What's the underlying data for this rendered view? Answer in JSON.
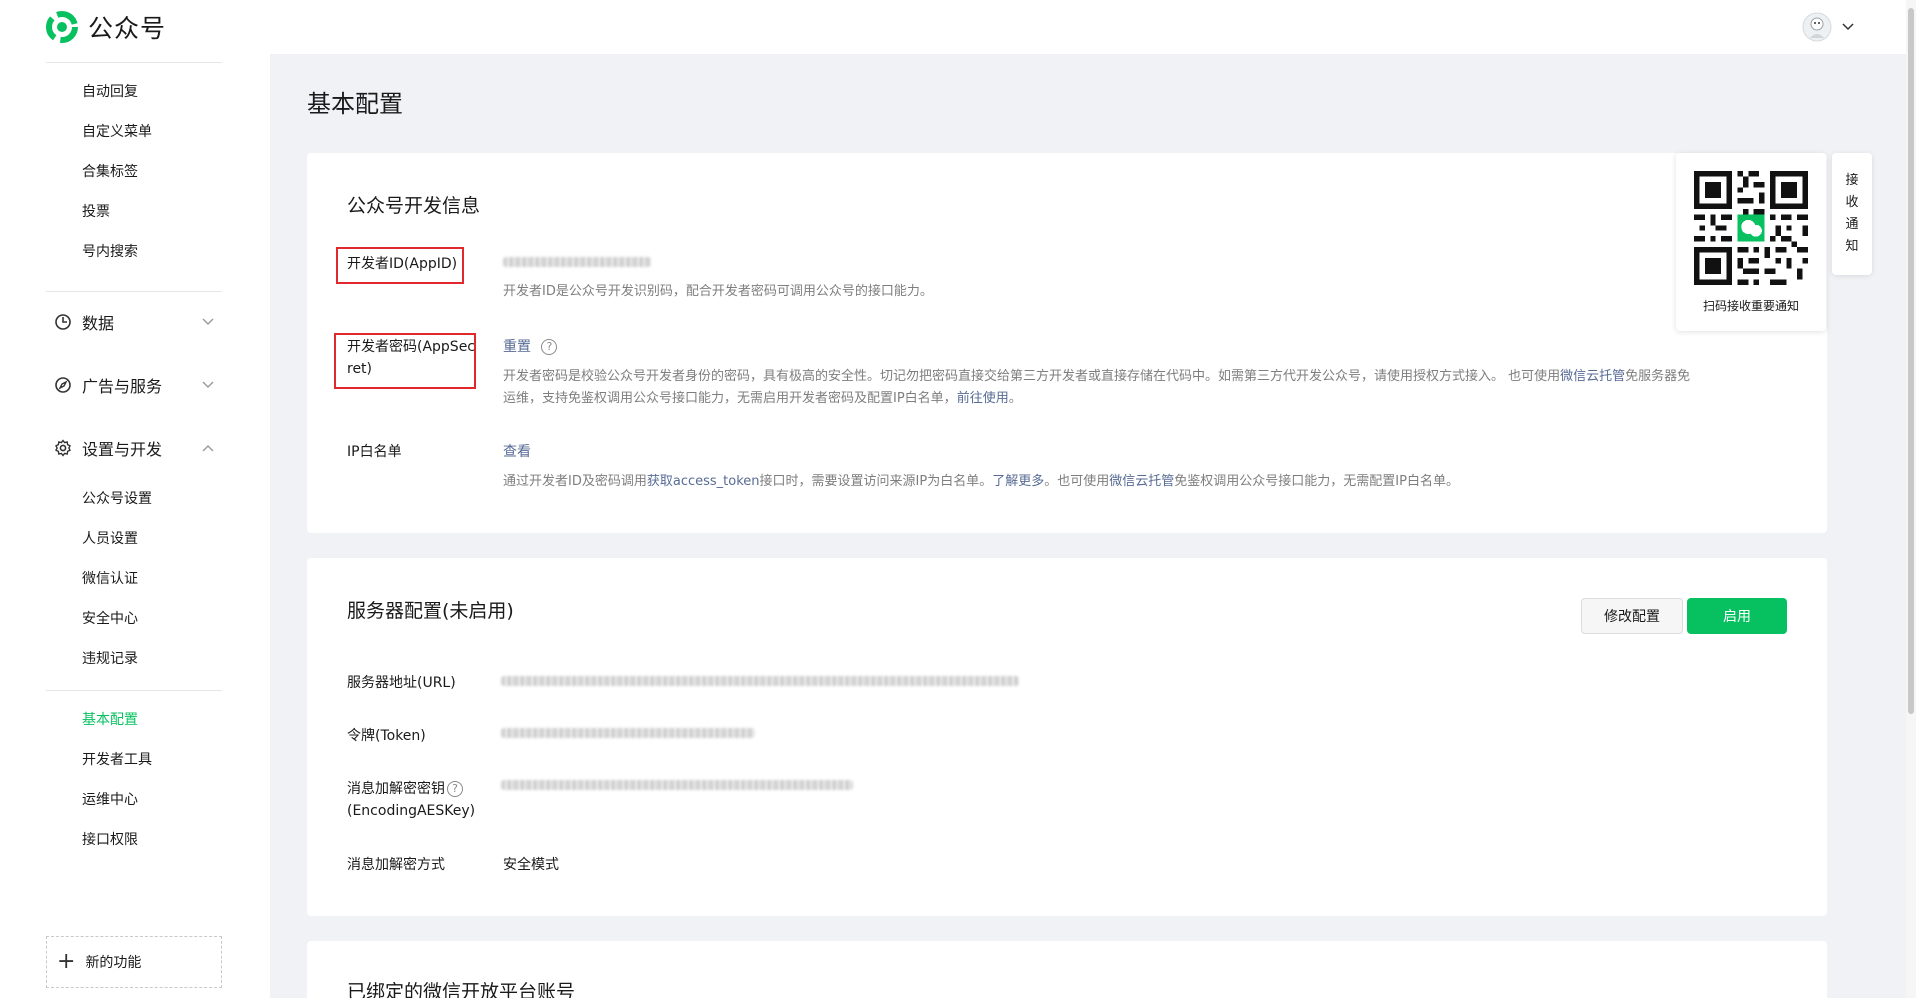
{
  "brand": {
    "name": "公众号",
    "accent": "#07c160"
  },
  "sidebar": {
    "top_items": [
      "自动回复",
      "自定义菜单",
      "合集标签",
      "投票",
      "号内搜索"
    ],
    "groups": {
      "data": {
        "label": "数据",
        "icon": "clock-icon",
        "expanded": false
      },
      "ads": {
        "label": "广告与服务",
        "icon": "compass-icon",
        "expanded": false
      },
      "settings": {
        "label": "设置与开发",
        "icon": "gear-icon",
        "expanded": true
      }
    },
    "settings_items": [
      "公众号设置",
      "人员设置",
      "微信认证",
      "安全中心",
      "违规记录"
    ],
    "dev_items": [
      "基本配置",
      "开发者工具",
      "运维中心",
      "接口权限"
    ],
    "active_item": "基本配置",
    "new_feature": "新的功能"
  },
  "page": {
    "title": "基本配置"
  },
  "dev_info": {
    "title": "公众号开发信息",
    "appid_label": "开发者ID(AppID)",
    "appid_desc": "开发者ID是公众号开发识别码，配合开发者密码可调用公众号的接口能力。",
    "secret_label_1": "开发者密码(AppSec",
    "secret_label_2": "ret)",
    "secret_action": "重置",
    "secret_desc_1a": "开发者密码是校验公众号开发者身份的密码，具有极高的安全性。切记勿把密码直接交给第三方开发者或直接存储在代码中。如需第三方代开发公众号，请使用授权方式接入。 也可使用",
    "secret_desc_1_link": "微信云托管",
    "secret_desc_1b": "免服务器免",
    "secret_desc_2a": "运维，支持免鉴权调用公众号接口能力，无需启用开发者密码及配置IP白名单，",
    "secret_desc_2_link": "前往使用",
    "secret_desc_2b": "。",
    "ip_label": "IP白名单",
    "ip_action": "查看",
    "ip_desc_a": "通过开发者ID及密码调用",
    "ip_desc_link1": "获取access_token",
    "ip_desc_b": "接口时，需要设置访问来源IP为白名单。",
    "ip_desc_link2": "了解更多",
    "ip_desc_c": "。也可使用",
    "ip_desc_link3": "微信云托管",
    "ip_desc_d": "免鉴权调用公众号接口能力，无需配置IP白名单。"
  },
  "server_config": {
    "title": "服务器配置(未启用)",
    "modify_button": "修改配置",
    "enable_button": "启用",
    "url_label": "服务器地址(URL)",
    "token_label": "令牌(Token)",
    "aes_label_1": "消息加解密密钥",
    "aes_label_2": "(EncodingAESKey)",
    "mode_label": "消息加解密方式",
    "mode_value": "安全模式"
  },
  "open_platform": {
    "title": "已绑定的微信开放平台账号"
  },
  "qr_popup": {
    "caption": "扫码接收重要通知",
    "tab_chars": [
      "接",
      "收",
      "通",
      "知"
    ]
  }
}
